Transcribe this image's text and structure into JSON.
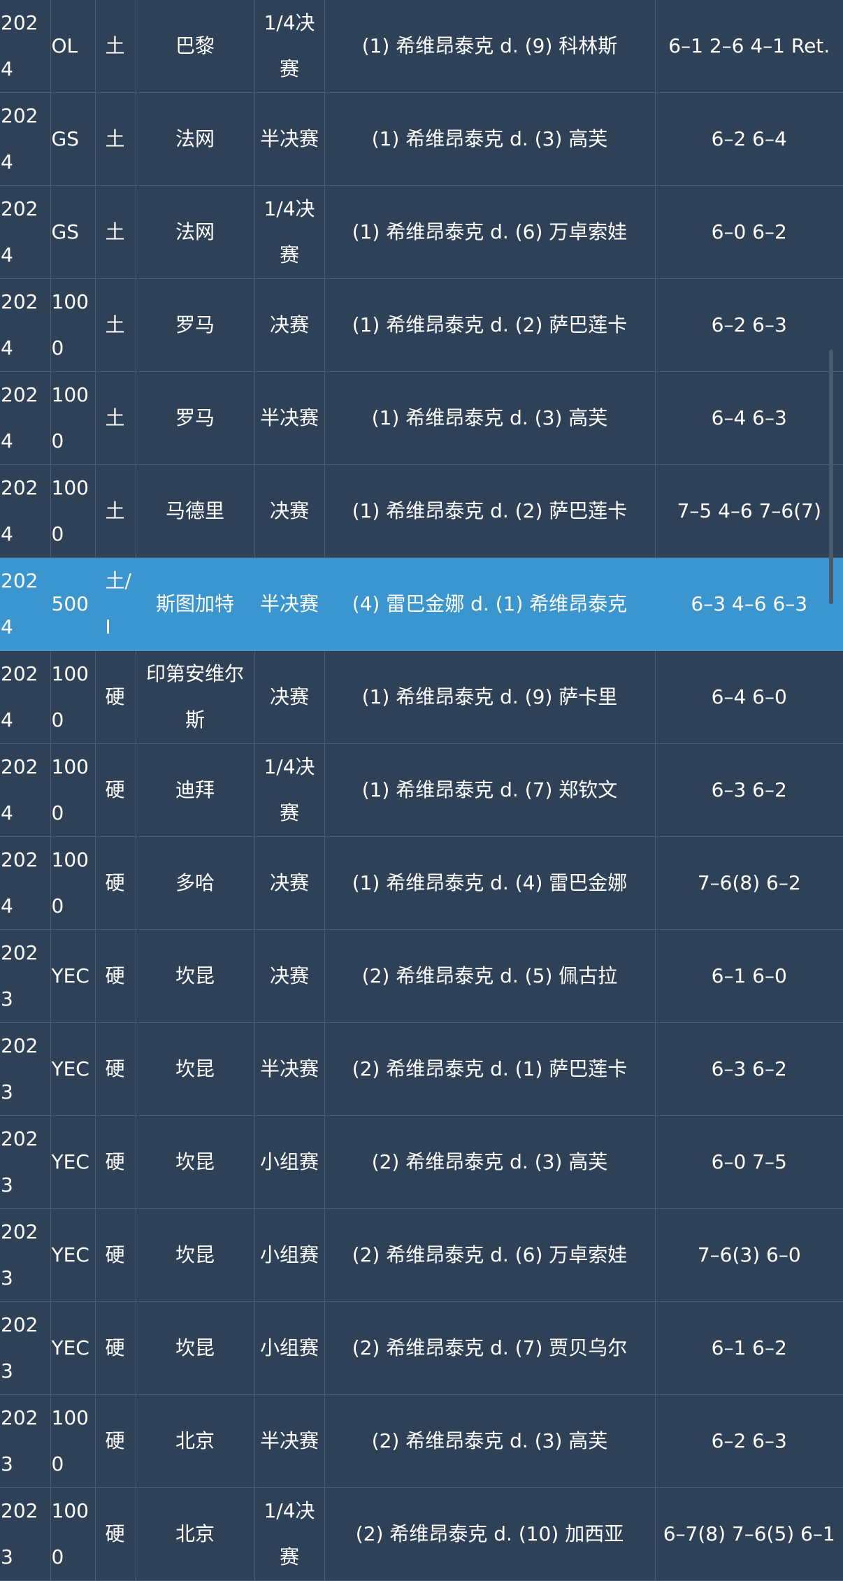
{
  "rows": [
    {
      "year": "2024",
      "level": "OL",
      "surface": "土",
      "city": "巴黎",
      "round": "1/4决赛",
      "match": "(1) 希维昂泰克 d. (9) 科林斯",
      "score": "6–1 2–6 4–1 Ret.",
      "tall": true,
      "highlight": false
    },
    {
      "year": "2024",
      "level": "GS",
      "surface": "土",
      "city": "法网",
      "round": "半决赛",
      "match": "(1) 希维昂泰克 d. (3) 高芙",
      "score": "6–2 6–4",
      "tall": false,
      "highlight": false
    },
    {
      "year": "2024",
      "level": "GS",
      "surface": "土",
      "city": "法网",
      "round": "1/4决赛",
      "match": "(1) 希维昂泰克 d. (6) 万卓索娃",
      "score": "6–0 6–2",
      "tall": true,
      "highlight": false
    },
    {
      "year": "2024",
      "level": "1000",
      "surface": "土",
      "city": "罗马",
      "round": "决赛",
      "match": "(1) 希维昂泰克 d. (2) 萨巴莲卡",
      "score": "6–2 6–3",
      "tall": false,
      "highlight": false
    },
    {
      "year": "2024",
      "level": "1000",
      "surface": "土",
      "city": "罗马",
      "round": "半决赛",
      "match": "(1) 希维昂泰克 d. (3) 高芙",
      "score": "6–4 6–3",
      "tall": false,
      "highlight": false
    },
    {
      "year": "2024",
      "level": "1000",
      "surface": "土",
      "city": "马德里",
      "round": "决赛",
      "match": "(1) 希维昂泰克 d. (2) 萨巴莲卡",
      "score": "7–5 4–6 7–6(7)",
      "tall": false,
      "highlight": false
    },
    {
      "year": "2024",
      "level": "500",
      "surface": "土/I",
      "city": "斯图加特",
      "round": "半决赛",
      "match": "(4) 雷巴金娜 d. (1) 希维昂泰克",
      "score": "6–3 4–6 6–3",
      "tall": false,
      "highlight": true
    },
    {
      "year": "2024",
      "level": "1000",
      "surface": "硬",
      "city": "印第安维尔斯",
      "round": "决赛",
      "match": "(1) 希维昂泰克 d. (9) 萨卡里",
      "score": "6–4 6–0",
      "tall": true,
      "highlight": false
    },
    {
      "year": "2024",
      "level": "1000",
      "surface": "硬",
      "city": "迪拜",
      "round": "1/4决赛",
      "match": "(1) 希维昂泰克 d. (7) 郑钦文",
      "score": "6–3 6–2",
      "tall": true,
      "highlight": false
    },
    {
      "year": "2024",
      "level": "1000",
      "surface": "硬",
      "city": "多哈",
      "round": "决赛",
      "match": "(1) 希维昂泰克 d. (4) 雷巴金娜",
      "score": "7–6(8) 6–2",
      "tall": false,
      "highlight": false
    },
    {
      "year": "2023",
      "level": "YEC",
      "surface": "硬",
      "city": "坎昆",
      "round": "决赛",
      "match": "(2) 希维昂泰克 d. (5) 佩古拉",
      "score": "6–1 6–0",
      "tall": false,
      "highlight": false
    },
    {
      "year": "2023",
      "level": "YEC",
      "surface": "硬",
      "city": "坎昆",
      "round": "半决赛",
      "match": "(2) 希维昂泰克 d. (1) 萨巴莲卡",
      "score": "6–3 6–2",
      "tall": false,
      "highlight": false
    },
    {
      "year": "2023",
      "level": "YEC",
      "surface": "硬",
      "city": "坎昆",
      "round": "小组赛",
      "match": "(2) 希维昂泰克 d. (3) 高芙",
      "score": "6–0 7–5",
      "tall": false,
      "highlight": false
    },
    {
      "year": "2023",
      "level": "YEC",
      "surface": "硬",
      "city": "坎昆",
      "round": "小组赛",
      "match": "(2) 希维昂泰克 d. (6) 万卓索娃",
      "score": "7–6(3) 6–0",
      "tall": false,
      "highlight": false
    },
    {
      "year": "2023",
      "level": "YEC",
      "surface": "硬",
      "city": "坎昆",
      "round": "小组赛",
      "match": "(2) 希维昂泰克 d. (7) 贾贝乌尔",
      "score": "6–1 6–2",
      "tall": false,
      "highlight": false
    },
    {
      "year": "2023",
      "level": "1000",
      "surface": "硬",
      "city": "北京",
      "round": "半决赛",
      "match": "(2) 希维昂泰克 d. (3) 高芙",
      "score": "6–2 6–3",
      "tall": false,
      "highlight": false
    },
    {
      "year": "2023",
      "level": "1000",
      "surface": "硬",
      "city": "北京",
      "round": "1/4决赛",
      "match": "(2) 希维昂泰克 d. (10) 加西亚",
      "score": "6–7(8) 7–6(5) 6–1",
      "tall": true,
      "highlight": false
    }
  ]
}
